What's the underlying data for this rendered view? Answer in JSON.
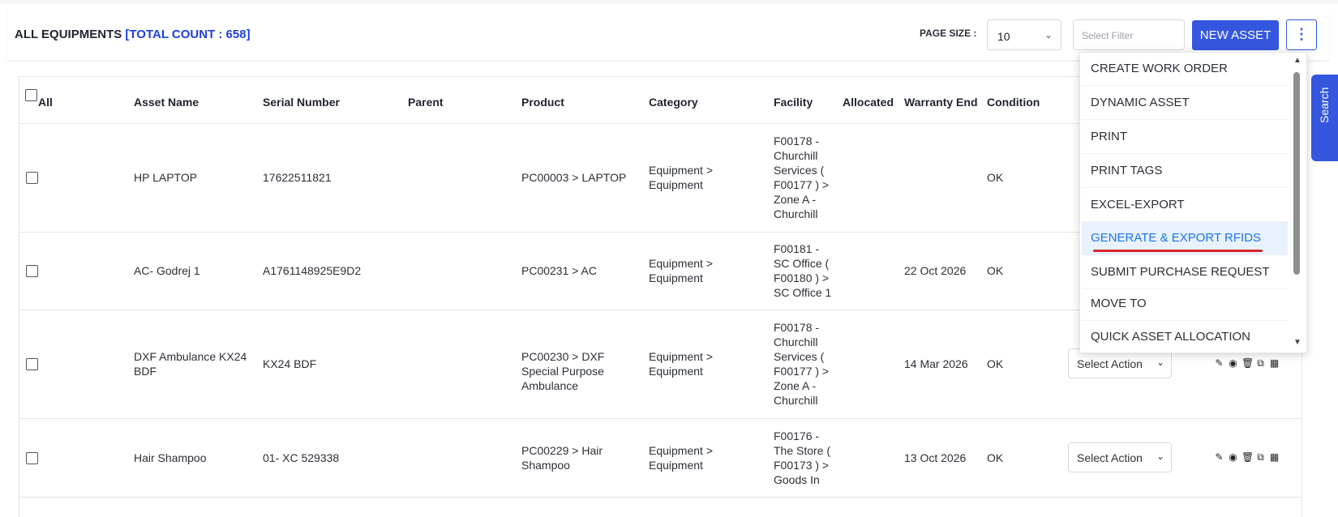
{
  "header": {
    "title": "ALL EQUIPMENTS",
    "count_label": "[TOTAL COUNT : 658]",
    "page_size_label": "PAGE SIZE :",
    "page_size_value": "10",
    "filter_placeholder": "Select Filter",
    "new_asset_label": "NEW ASSET",
    "more_icon": "⋮"
  },
  "table": {
    "columns": [
      "All",
      "Asset Name",
      "Serial Number",
      "Parent",
      "Product",
      "Category",
      "Facility",
      "Allocated",
      "Warranty End",
      "Condition"
    ],
    "rows": [
      {
        "asset_name": "HP LAPTOP",
        "serial": "17622511821",
        "parent": "",
        "product": "PC00003 > LAPTOP",
        "category": "Equipment > Equipment",
        "facility": "F00178 - Churchill Services ( F00177 ) > Zone A - Churchill",
        "allocated": "",
        "warranty": "",
        "condition": "OK",
        "action": ""
      },
      {
        "asset_name": "AC- Godrej 1",
        "serial": "A1761148925E9D2",
        "parent": "",
        "product": "PC00231 > AC",
        "category": "Equipment > Equipment",
        "facility": "F00181 - SC Office ( F00180 ) > SC Office 1",
        "allocated": "",
        "warranty": "22 Oct 2026",
        "condition": "OK",
        "action": ""
      },
      {
        "asset_name": "DXF Ambulance KX24 BDF",
        "serial": "KX24 BDF",
        "parent": "",
        "product": "PC00230 > DXF Special Purpose Ambulance",
        "category": "Equipment > Equipment",
        "facility": "F00178 - Churchill Services ( F00177 ) > Zone A - Churchill",
        "allocated": "",
        "warranty": "14 Mar 2026",
        "condition": "OK",
        "action": "Select Action"
      },
      {
        "asset_name": "Hair Shampoo",
        "serial": "01- XC 529338",
        "parent": "",
        "product": "PC00229 > Hair Shampoo",
        "category": "Equipment > Equipment",
        "facility": "F00176 - The Store ( F00173 ) > Goods In",
        "allocated": "",
        "warranty": "13 Oct 2026",
        "condition": "OK",
        "action": "Select Action"
      }
    ]
  },
  "row_icons": [
    "pencil-icon",
    "eye-icon",
    "trash-icon",
    "copy-icon",
    "qr-icon"
  ],
  "dropdown": {
    "items": [
      "CREATE WORK ORDER",
      "DYNAMIC ASSET",
      "PRINT",
      "PRINT TAGS",
      "EXCEL-EXPORT",
      "GENERATE & EXPORT RFIDS",
      "SUBMIT PURCHASE REQUEST",
      "MOVE TO",
      "QUICK ASSET ALLOCATION"
    ],
    "active_index": 5
  },
  "side_tab": {
    "label": "Search"
  },
  "colors": {
    "accent": "#3556de",
    "count": "#1f3fe0",
    "active_item": "#1a73e8",
    "underline": "#d9242b"
  }
}
